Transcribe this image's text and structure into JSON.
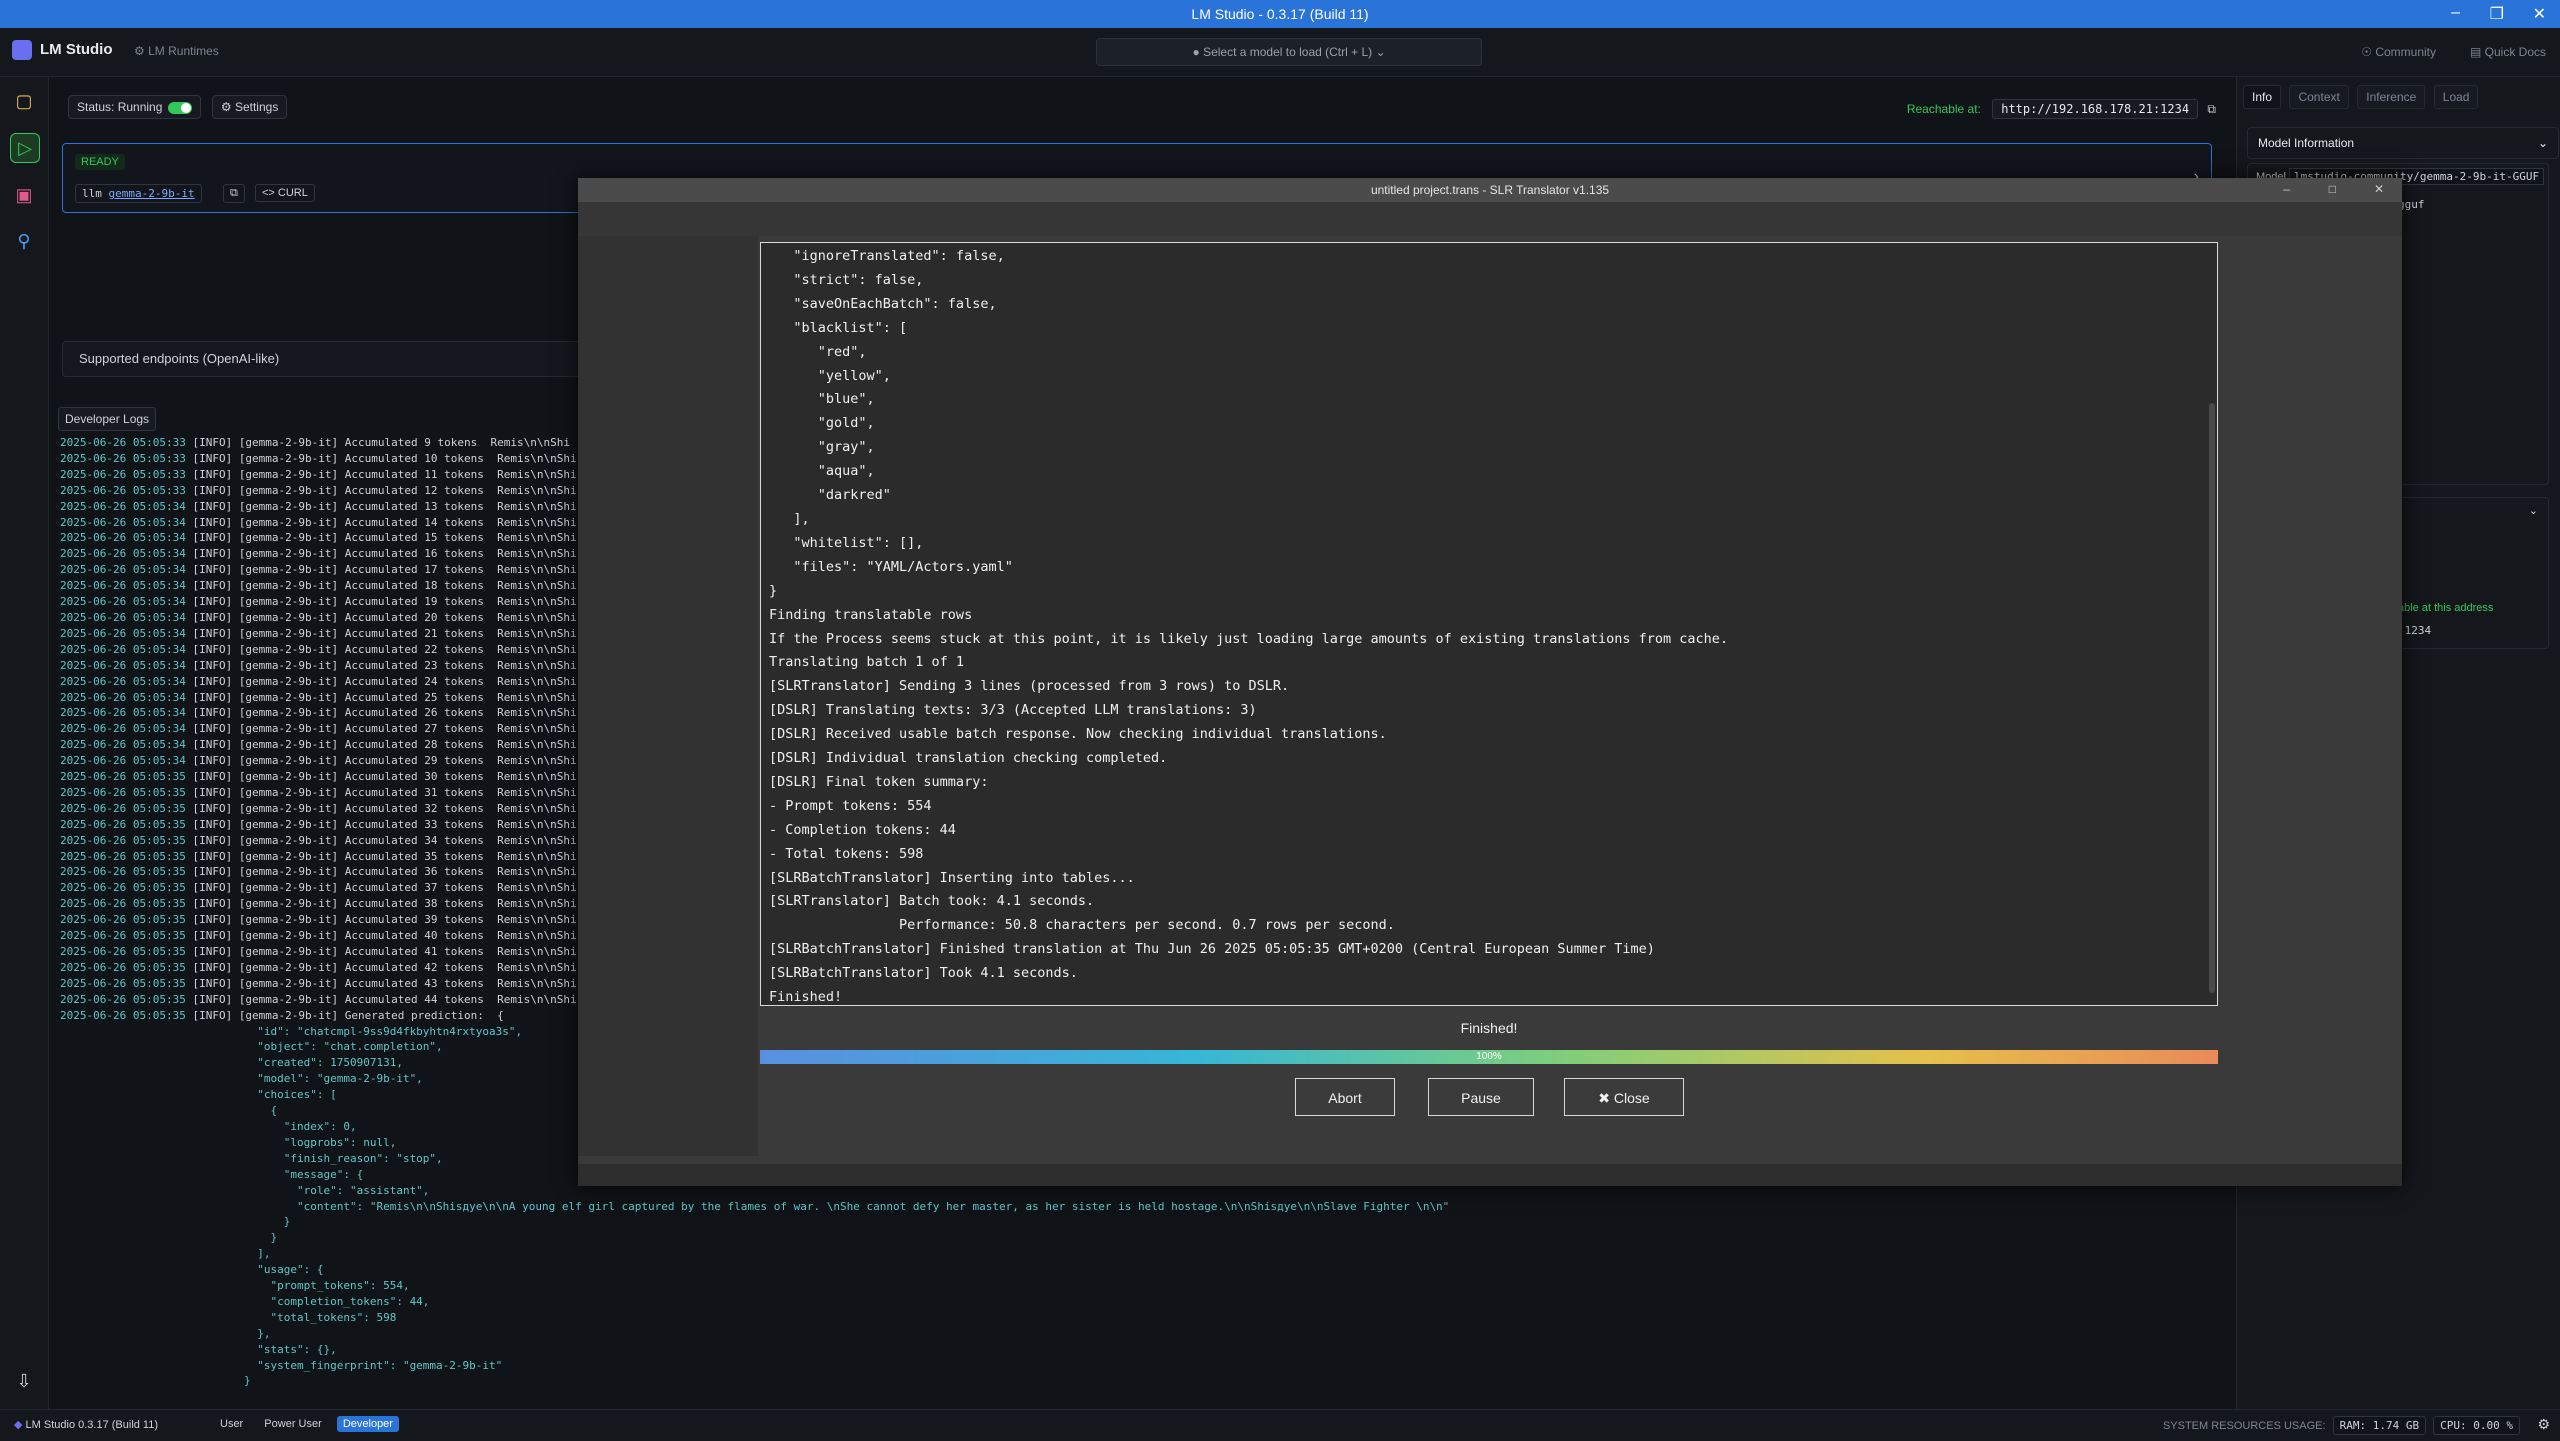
{
  "window": {
    "title": "LM Studio - 0.3.17 (Build 11)"
  },
  "appbar": {
    "brand": "LM Studio",
    "runtimes": "LM Runtimes",
    "model_select": "Select a model to load  (Ctrl + L)",
    "community": "Community",
    "quick_docs": "Quick Docs"
  },
  "server": {
    "status": "Status: Running",
    "settings": "Settings",
    "reachable_label": "Reachable at:",
    "reachable_url": "http://192.168.178.21:1234",
    "ready": "READY",
    "model_prefix": "llm",
    "model_name": "gemma-2-9b-it",
    "curl": "CURL",
    "endpoints": "Supported endpoints (OpenAI-like)",
    "devlogs_tab": "Developer Logs"
  },
  "logs": {
    "lines": [
      [
        "2025-06-26 05:05:33",
        "[INFO]",
        "[gemma-2-9b-it] Accumulated 9 tokens  Remis\\n\\nShi"
      ],
      [
        "2025-06-26 05:05:33",
        "[INFO]",
        "[gemma-2-9b-it] Accumulated 10 tokens  Remis\\n\\nShi"
      ],
      [
        "2025-06-26 05:05:33",
        "[INFO]",
        "[gemma-2-9b-it] Accumulated 11 tokens  Remis\\n\\nShi"
      ],
      [
        "2025-06-26 05:05:33",
        "[INFO]",
        "[gemma-2-9b-it] Accumulated 12 tokens  Remis\\n\\nShi"
      ],
      [
        "2025-06-26 05:05:34",
        "[INFO]",
        "[gemma-2-9b-it] Accumulated 13 tokens  Remis\\n\\nShi"
      ],
      [
        "2025-06-26 05:05:34",
        "[INFO]",
        "[gemma-2-9b-it] Accumulated 14 tokens  Remis\\n\\nShi"
      ],
      [
        "2025-06-26 05:05:34",
        "[INFO]",
        "[gemma-2-9b-it] Accumulated 15 tokens  Remis\\n\\nShi"
      ],
      [
        "2025-06-26 05:05:34",
        "[INFO]",
        "[gemma-2-9b-it] Accumulated 16 tokens  Remis\\n\\nShi"
      ],
      [
        "2025-06-26 05:05:34",
        "[INFO]",
        "[gemma-2-9b-it] Accumulated 17 tokens  Remis\\n\\nShi"
      ],
      [
        "2025-06-26 05:05:34",
        "[INFO]",
        "[gemma-2-9b-it] Accumulated 18 tokens  Remis\\n\\nShi"
      ],
      [
        "2025-06-26 05:05:34",
        "[INFO]",
        "[gemma-2-9b-it] Accumulated 19 tokens  Remis\\n\\nShi"
      ],
      [
        "2025-06-26 05:05:34",
        "[INFO]",
        "[gemma-2-9b-it] Accumulated 20 tokens  Remis\\n\\nShi"
      ],
      [
        "2025-06-26 05:05:34",
        "[INFO]",
        "[gemma-2-9b-it] Accumulated 21 tokens  Remis\\n\\nShi"
      ],
      [
        "2025-06-26 05:05:34",
        "[INFO]",
        "[gemma-2-9b-it] Accumulated 22 tokens  Remis\\n\\nShi"
      ],
      [
        "2025-06-26 05:05:34",
        "[INFO]",
        "[gemma-2-9b-it] Accumulated 23 tokens  Remis\\n\\nShi"
      ],
      [
        "2025-06-26 05:05:34",
        "[INFO]",
        "[gemma-2-9b-it] Accumulated 24 tokens  Remis\\n\\nShi"
      ],
      [
        "2025-06-26 05:05:34",
        "[INFO]",
        "[gemma-2-9b-it] Accumulated 25 tokens  Remis\\n\\nShi"
      ],
      [
        "2025-06-26 05:05:34",
        "[INFO]",
        "[gemma-2-9b-it] Accumulated 26 tokens  Remis\\n\\nShi"
      ],
      [
        "2025-06-26 05:05:34",
        "[INFO]",
        "[gemma-2-9b-it] Accumulated 27 tokens  Remis\\n\\nShi"
      ],
      [
        "2025-06-26 05:05:34",
        "[INFO]",
        "[gemma-2-9b-it] Accumulated 28 tokens  Remis\\n\\nShi"
      ],
      [
        "2025-06-26 05:05:34",
        "[INFO]",
        "[gemma-2-9b-it] Accumulated 29 tokens  Remis\\n\\nShi"
      ],
      [
        "2025-06-26 05:05:35",
        "[INFO]",
        "[gemma-2-9b-it] Accumulated 30 tokens  Remis\\n\\nShi"
      ],
      [
        "2025-06-26 05:05:35",
        "[INFO]",
        "[gemma-2-9b-it] Accumulated 31 tokens  Remis\\n\\nShi"
      ],
      [
        "2025-06-26 05:05:35",
        "[INFO]",
        "[gemma-2-9b-it] Accumulated 32 tokens  Remis\\n\\nShi"
      ],
      [
        "2025-06-26 05:05:35",
        "[INFO]",
        "[gemma-2-9b-it] Accumulated 33 tokens  Remis\\n\\nShi"
      ],
      [
        "2025-06-26 05:05:35",
        "[INFO]",
        "[gemma-2-9b-it] Accumulated 34 tokens  Remis\\n\\nShi"
      ],
      [
        "2025-06-26 05:05:35",
        "[INFO]",
        "[gemma-2-9b-it] Accumulated 35 tokens  Remis\\n\\nShi"
      ],
      [
        "2025-06-26 05:05:35",
        "[INFO]",
        "[gemma-2-9b-it] Accumulated 36 tokens  Remis\\n\\nShi"
      ],
      [
        "2025-06-26 05:05:35",
        "[INFO]",
        "[gemma-2-9b-it] Accumulated 37 tokens  Remis\\n\\nShi"
      ],
      [
        "2025-06-26 05:05:35",
        "[INFO]",
        "[gemma-2-9b-it] Accumulated 38 tokens  Remis\\n\\nShi"
      ],
      [
        "2025-06-26 05:05:35",
        "[INFO]",
        "[gemma-2-9b-it] Accumulated 39 tokens  Remis\\n\\nShi"
      ],
      [
        "2025-06-26 05:05:35",
        "[INFO]",
        "[gemma-2-9b-it] Accumulated 40 tokens  Remis\\n\\nShi"
      ],
      [
        "2025-06-26 05:05:35",
        "[INFO]",
        "[gemma-2-9b-it] Accumulated 41 tokens  Remis\\n\\nShi"
      ],
      [
        "2025-06-26 05:05:35",
        "[INFO]",
        "[gemma-2-9b-it] Accumulated 42 tokens  Remis\\n\\nShi"
      ],
      [
        "2025-06-26 05:05:35",
        "[INFO]",
        "[gemma-2-9b-it] Accumulated 43 tokens  Remis\\n\\nShi"
      ],
      [
        "2025-06-26 05:05:35",
        "[INFO]",
        "[gemma-2-9b-it] Accumulated 44 tokens  Remis\\n\\nShi"
      ],
      [
        "2025-06-26 05:05:35",
        "[INFO]",
        "[gemma-2-9b-it] Generated prediction:  {"
      ]
    ],
    "json_lines": [
      "  \"id\": \"chatcmpl-9ss9d4fkbyhtn4rxtyoa3s\",",
      "  \"object\": \"chat.completion\",",
      "  \"created\": 1750907131,",
      "  \"model\": \"gemma-2-9b-it\",",
      "  \"choices\": [",
      "    {",
      "      \"index\": 0,",
      "      \"logprobs\": null,",
      "      \"finish_reason\": \"stop\",",
      "      \"message\": {",
      "        \"role\": \"assistant\",",
      "        \"content\": \"Remis\\n\\nShisдуе\\n\\nA young elf girl captured by the flames of war. \\nShe cannot defy her master, as her sister is held hostage.\\n\\nShisдуе\\n\\nSlave Fighter \\n\\n\"",
      "      }",
      "    }",
      "  ],",
      "  \"usage\": {",
      "    \"prompt_tokens\": 554,",
      "    \"completion_tokens\": 44,",
      "    \"total_tokens\": 598",
      "  },",
      "  \"stats\": {},",
      "  \"system_fingerprint\": \"gemma-2-9b-it\"",
      "}"
    ]
  },
  "right_panel": {
    "tabs": [
      "Info",
      "Context",
      "Inference",
      "Load"
    ],
    "model_info": "Model Information",
    "model_label": "Model",
    "model_value": "lmstudio-community/gemma-2-9b-it-GGUF",
    "file_frag": "gguf",
    "reach_frag": "able at this address",
    "port_frag": ":1234"
  },
  "statusbar": {
    "brand": "LM Studio 0.3.17 (Build 11)",
    "modes": [
      "User",
      "Power User",
      "Developer"
    ],
    "resources_label": "SYSTEM RESOURCES USAGE:",
    "ram": "RAM: 1.74 GB",
    "cpu": "CPU: 0.00 %"
  },
  "dialog": {
    "title": "untitled project.trans - SLR Translator v1.135",
    "console": "   \"ignoreTranslated\": false,\n   \"strict\": false,\n   \"saveOnEachBatch\": false,\n   \"blacklist\": [\n      \"red\",\n      \"yellow\",\n      \"blue\",\n      \"gold\",\n      \"gray\",\n      \"aqua\",\n      \"darkred\"\n   ],\n   \"whitelist\": [],\n   \"files\": \"YAML/Actors.yaml\"\n}\nFinding translatable rows\nIf the Process seems stuck at this point, it is likely just loading large amounts of existing translations from cache.\nTranslating batch 1 of 1\n[SLRTranslator] Sending 3 lines (processed from 3 rows) to DSLR.\n[DSLR] Translating texts: 3/3 (Accepted LLM translations: 3)\n[DSLR] Received usable batch response. Now checking individual translations.\n[DSLR] Individual translation checking completed.\n[DSLR] Final token summary:\n- Prompt tokens: 554\n- Completion tokens: 44\n- Total tokens: 598\n[SLRBatchTranslator] Inserting into tables...\n[SLRTranslator] Batch took: 4.1 seconds.\n                Performance: 50.8 characters per second. 0.7 rows per second.\n[SLRBatchTranslator] Finished translation at Thu Jun 26 2025 05:05:35 GMT+0200 (Central European Summer Time)\n[SLRBatchTranslator] Took 4.1 seconds.\nFinished!",
    "status": "Finished!",
    "progress_text": "100%",
    "progress_value": 1.0,
    "buttons": {
      "abort": "Abort",
      "pause": "Pause",
      "close": "Close"
    }
  }
}
